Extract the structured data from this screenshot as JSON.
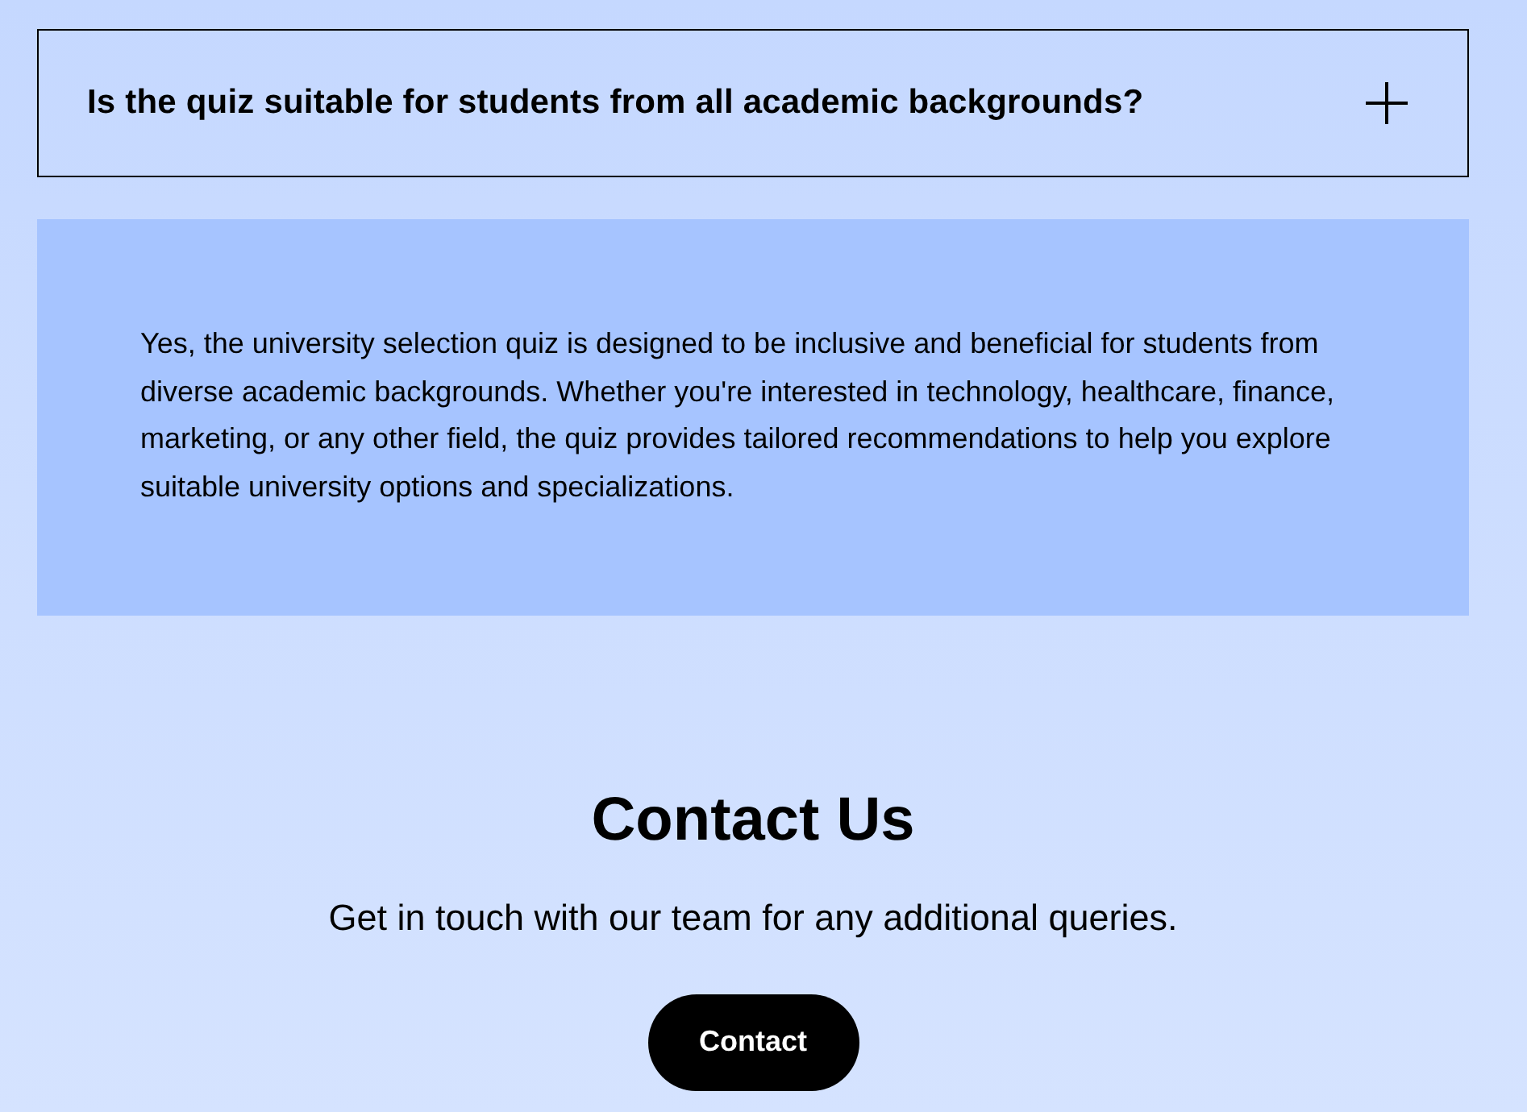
{
  "faq": {
    "question": "Is the quiz suitable for students from all academic backgrounds?",
    "answer": "Yes, the university selection quiz is designed to be inclusive and beneficial for students from diverse academic backgrounds. Whether you're interested in technology, healthcare, finance, marketing, or any other field, the quiz provides tailored recommendations to help you explore suitable university options and specializations."
  },
  "contact": {
    "title": "Contact Us",
    "subtitle": "Get in touch with our team for any additional queries.",
    "button": "Contact"
  }
}
